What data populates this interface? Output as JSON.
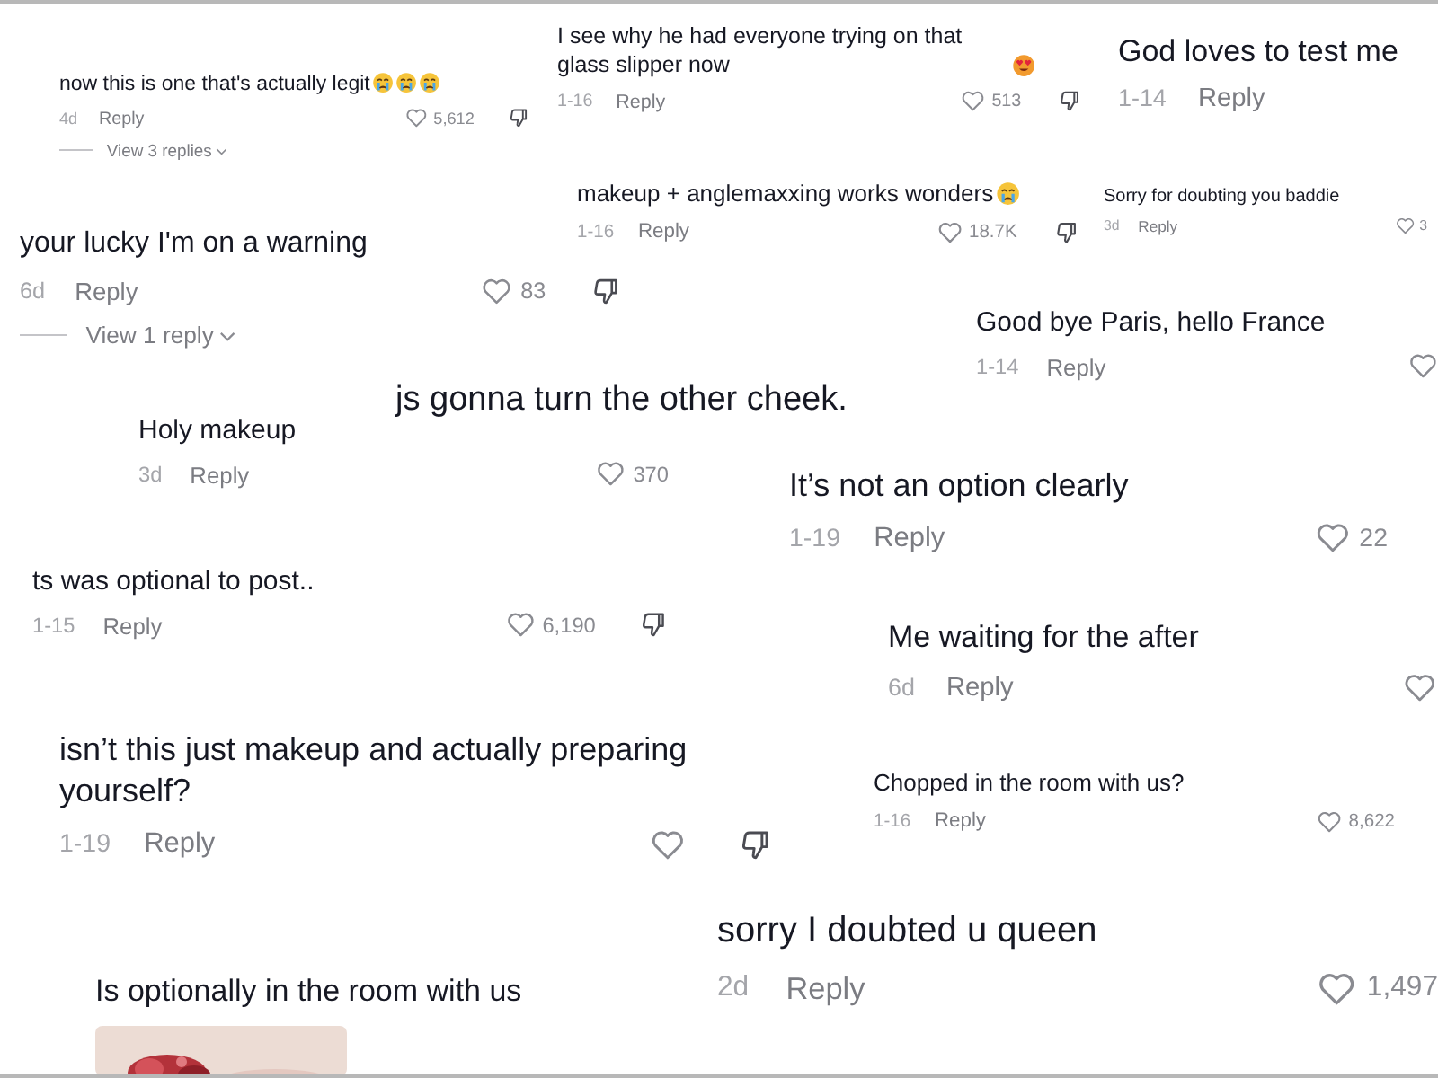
{
  "comments": [
    {
      "text": "now this is one that's actually legit",
      "emojis": [
        {
          "kind": "crying"
        },
        {
          "kind": "crying"
        },
        {
          "kind": "crying"
        }
      ],
      "date": "4d",
      "reply": "Reply",
      "heart": true,
      "likes": "5,612",
      "dislike": true,
      "view_replies": "View 3 replies"
    },
    {
      "text": "I see why he had everyone trying on that glass slipper now",
      "emojis": [
        {
          "kind": "heart-eyes"
        }
      ],
      "date": "1-16",
      "reply": "Reply",
      "heart": true,
      "likes": "513",
      "dislike": true
    },
    {
      "text": "God loves to test me",
      "date": "1-14",
      "reply": "Reply",
      "heart": false,
      "dislike": false
    },
    {
      "text": "makeup + anglemaxxing works wonders",
      "emojis": [
        {
          "kind": "crying"
        }
      ],
      "date": "1-16",
      "reply": "Reply",
      "heart": true,
      "likes": "18.7K",
      "dislike": true
    },
    {
      "text": "Sorry for doubting you baddie",
      "date": "3d",
      "reply": "Reply",
      "heart": true,
      "likes": "3",
      "dislike": false
    },
    {
      "text": "your lucky I'm on a warning",
      "date": "6d",
      "reply": "Reply",
      "heart": true,
      "likes": "83",
      "dislike": true,
      "view_replies": "View 1 reply"
    },
    {
      "text": "Good bye Paris, hello France",
      "date": "1-14",
      "reply": "Reply",
      "heart": true,
      "dislike": false
    },
    {
      "text": "js gonna turn the other cheek.",
      "heart": false,
      "dislike": false
    },
    {
      "text": "Holy makeup",
      "date": "3d",
      "reply": "Reply",
      "heart": true,
      "likes": "370",
      "dislike": false
    },
    {
      "text": "It’s not an option clearly",
      "date": "1-19",
      "reply": "Reply",
      "heart": true,
      "likes": "22",
      "dislike": false
    },
    {
      "text": "ts was optional to post..",
      "date": "1-15",
      "reply": "Reply",
      "heart": true,
      "likes": "6,190",
      "dislike": true
    },
    {
      "text": "Me waiting for the after",
      "date": "6d",
      "reply": "Reply",
      "heart": true,
      "dislike": false
    },
    {
      "text": "isn’t this just makeup and actually preparing yourself?",
      "date": "1-19",
      "reply": "Reply",
      "heart": true,
      "dislike": true
    },
    {
      "text": "Chopped in the room with us?",
      "date": "1-16",
      "reply": "Reply",
      "heart": true,
      "likes": "8,622",
      "dislike": false
    },
    {
      "text": "Is optionally in the room with us",
      "heart": false,
      "dislike": false
    },
    {
      "text": "sorry I doubted u queen",
      "date": "2d",
      "reply": "Reply",
      "heart": true,
      "likes": "1,497",
      "dislike": false
    }
  ]
}
